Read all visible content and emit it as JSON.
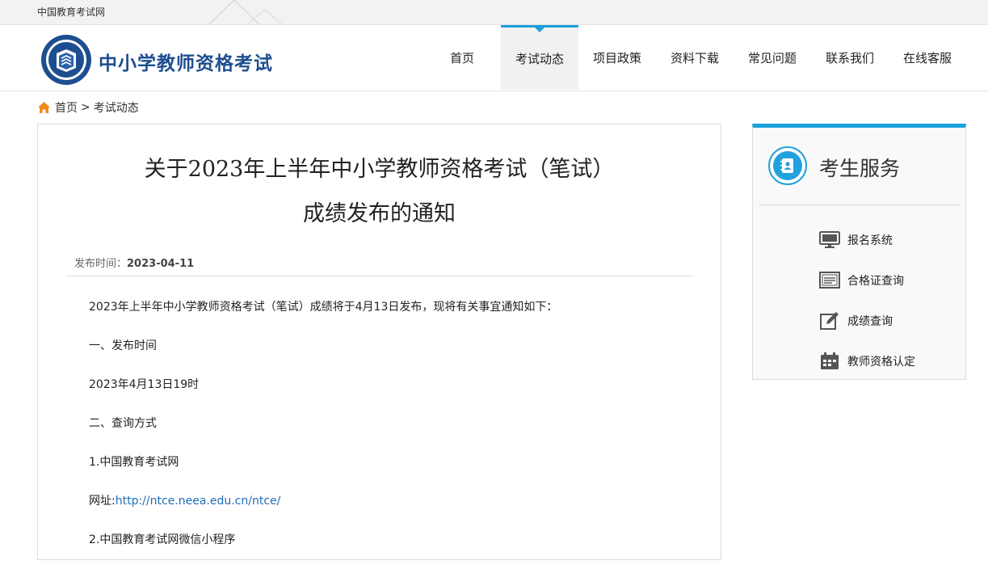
{
  "topbar": {
    "site_name": "中国教育考试网"
  },
  "header": {
    "logo_text": "中小学教师资格考试",
    "nav": [
      {
        "label": "首页",
        "active": false
      },
      {
        "label": "考试动态",
        "active": true
      },
      {
        "label": "项目政策",
        "active": false
      },
      {
        "label": "资料下载",
        "active": false
      },
      {
        "label": "常见问题",
        "active": false
      },
      {
        "label": "联系我们",
        "active": false
      },
      {
        "label": "在线客服",
        "active": false
      }
    ]
  },
  "breadcrumb": {
    "home": "首页",
    "separator": ">",
    "current": "考试动态"
  },
  "article": {
    "title_line1": "关于2023年上半年中小学教师资格考试（笔试）",
    "title_line2": "成绩发布的通知",
    "pubtime_label": "发布时间：",
    "pubtime_value": "2023-04-11",
    "paragraphs": [
      "2023年上半年中小学教师资格考试（笔试）成绩将于4月13日发布，现将有关事宜通知如下：",
      "一、发布时间",
      "2023年4月13日19时",
      "二、查询方式",
      "1.中国教育考试网"
    ],
    "url_label": "网址:",
    "url": "http://ntce.neea.edu.cn/ntce/",
    "paragraph_after_url": "2.中国教育考试网微信小程序"
  },
  "sidebar": {
    "title": "考生服务",
    "items": [
      {
        "label": "报名系统",
        "icon": "monitor-icon"
      },
      {
        "label": "合格证查询",
        "icon": "certificate-icon"
      },
      {
        "label": "成绩查询",
        "icon": "edit-icon"
      },
      {
        "label": "教师资格认定",
        "icon": "calendar-icon"
      }
    ]
  },
  "colors": {
    "accent": "#1ba0de",
    "logo_blue": "#1d4e8f",
    "link": "#1f6db7",
    "home_icon": "#f08a1c"
  }
}
